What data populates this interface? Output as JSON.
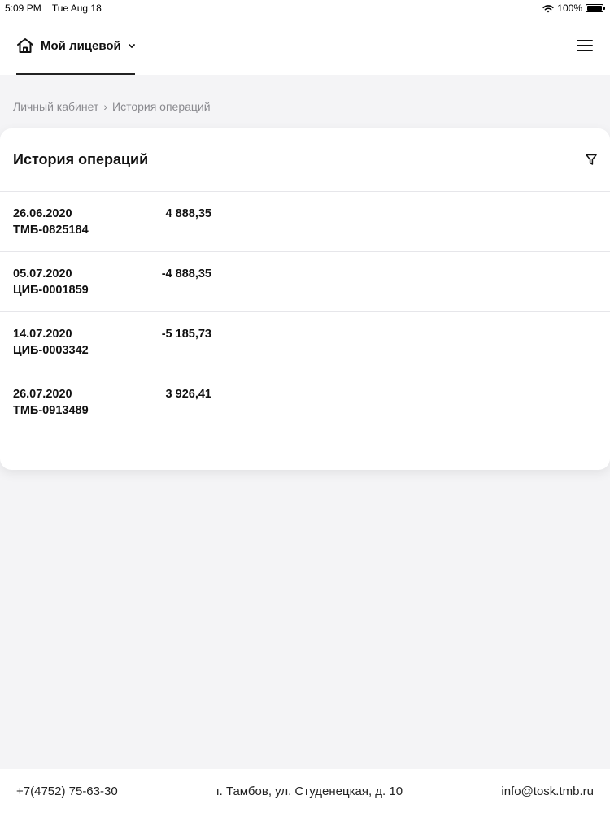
{
  "status_bar": {
    "time": "5:09 PM",
    "date": "Tue Aug 18",
    "battery": "100%",
    "battery_level": 1.0
  },
  "header": {
    "account_label": "Мой лицевой",
    "icons": {
      "home": "home-icon",
      "chevron": "chevron-down-icon",
      "menu": "hamburger-menu-icon"
    }
  },
  "breadcrumb": {
    "items": [
      "Личный кабинет",
      "История операций"
    ],
    "separator": "›"
  },
  "card": {
    "title": "История операций",
    "filter_icon": "filter-icon"
  },
  "operations": [
    {
      "date": "26.06.2020",
      "doc": "ТМБ-0825184",
      "amount": "4 888,35"
    },
    {
      "date": "05.07.2020",
      "doc": "ЦИБ-0001859",
      "amount": "-4 888,35"
    },
    {
      "date": "14.07.2020",
      "doc": "ЦИБ-0003342",
      "amount": "-5 185,73"
    },
    {
      "date": "26.07.2020",
      "doc": "ТМБ-0913489",
      "amount": "3 926,41"
    }
  ],
  "footer": {
    "phone": "+7(4752) 75-63-30",
    "address": "г. Тамбов, ул. Студенецкая, д. 10",
    "email": "info@tosk.tmb.ru"
  }
}
